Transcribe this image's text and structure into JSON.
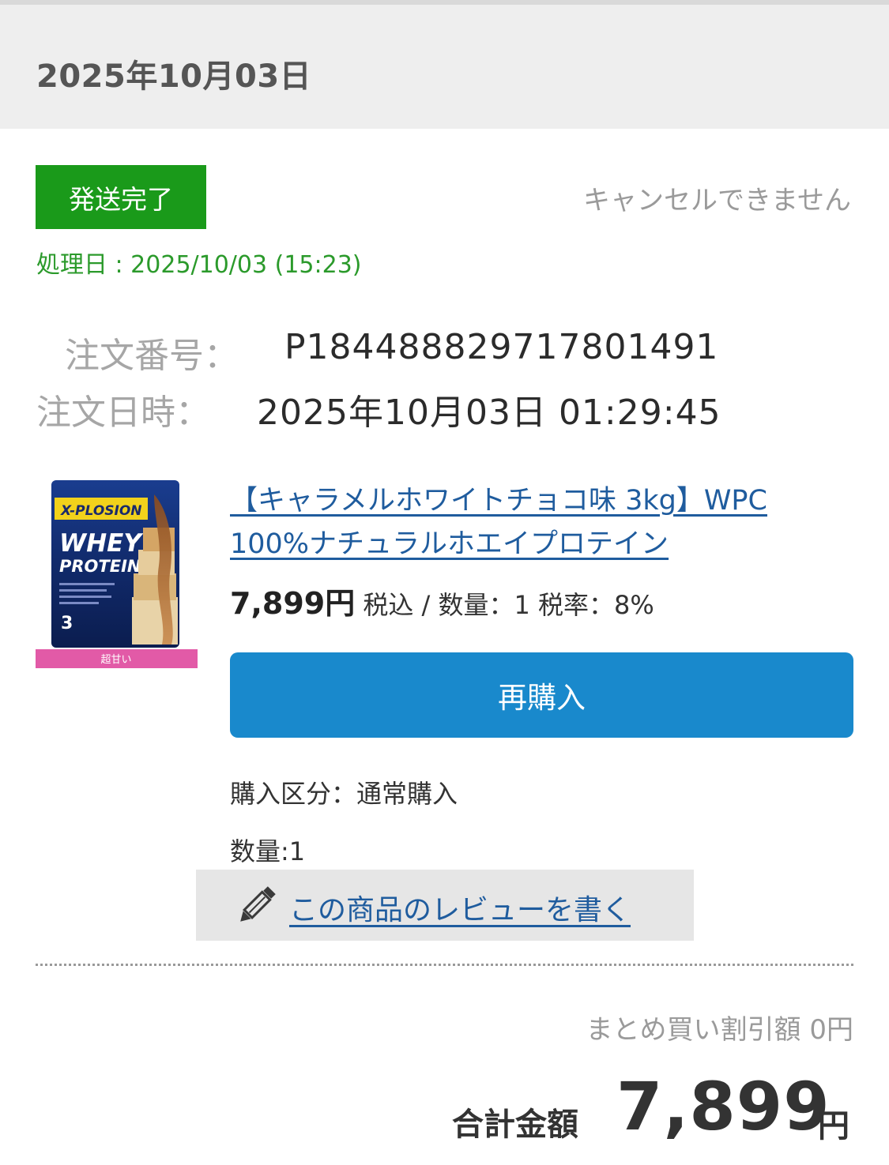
{
  "header": {
    "date": "2025年10月03日"
  },
  "status": {
    "badge": "発送完了",
    "cancel_note": "キャンセルできません",
    "processed_date": "処理日 : 2025/10/03 (15:23)",
    "badge_color": "#1a9a1a"
  },
  "order": {
    "number_label": "注文番号：",
    "number_value": "P184488829717801491",
    "datetime_label": "注文日時：",
    "datetime_value": "2025年10月03日 01:29:45"
  },
  "product": {
    "title": "【キャラメルホワイトチョコ味 3kg】WPC 100%ナチュラルホエイプロテイン",
    "price": "7,899円",
    "price_detail": " 税込 / 数量：1 税率：8%",
    "image": {
      "brand": "X-PLOSION",
      "line1": "WHEY",
      "line2": "PROTEIN",
      "size": "3",
      "tag": "超甘い"
    },
    "rebuy_label": "再購入",
    "purchase_type": "購入区分：通常購入",
    "quantity": "数量:1",
    "review_link": "この商品のレビューを書く"
  },
  "summary": {
    "discount": "まとめ買い割引額 0円",
    "total_label": "合計金額",
    "total_value": "7,899",
    "total_unit": "円"
  },
  "colors": {
    "accent_blue": "#1989cc",
    "link_blue": "#1f5c9e",
    "status_green": "#2b9a2b"
  }
}
